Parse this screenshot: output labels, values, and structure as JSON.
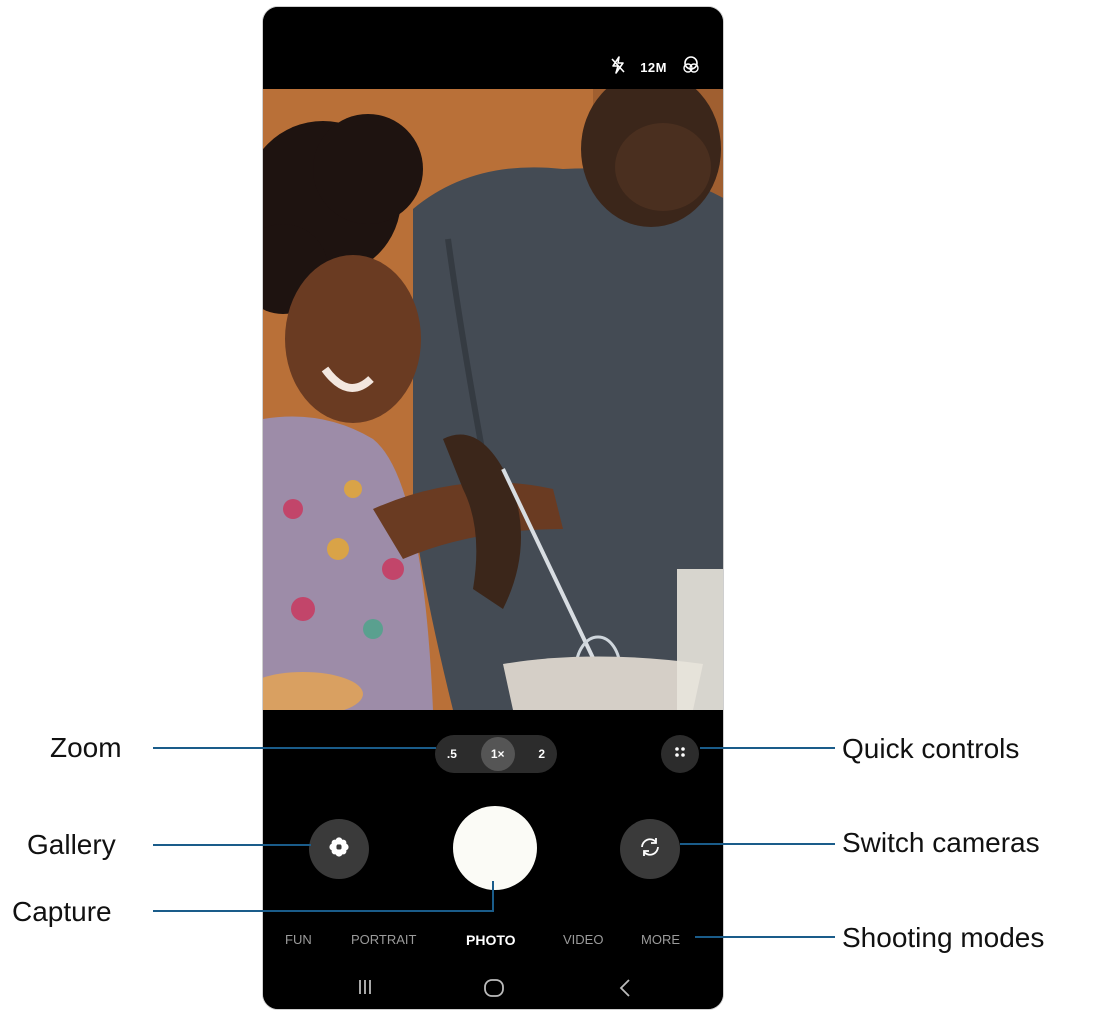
{
  "status": {
    "resolution": "12M"
  },
  "zoom": {
    "options": [
      ".5",
      "1×",
      "2"
    ],
    "active": "1×"
  },
  "modes": [
    "FUN",
    "PORTRAIT",
    "PHOTO",
    "VIDEO",
    "MORE"
  ],
  "active_mode": "PHOTO",
  "callouts": {
    "zoom": "Zoom",
    "gallery": "Gallery",
    "capture": "Capture",
    "quick_controls": "Quick controls",
    "switch_cameras": "Switch cameras",
    "shooting_modes": "Shooting modes"
  },
  "icons": {
    "flash": "flash-off-icon",
    "filter": "filter-icon",
    "gallery": "gallery-icon",
    "switch": "switch-camera-icon",
    "quick": "quick-controls-icon",
    "nav_recent": "recent-apps-icon",
    "nav_home": "home-icon",
    "nav_back": "back-icon"
  },
  "colors": {
    "callout_line": "#1a5c8a",
    "capture": "#fbfbf6"
  }
}
